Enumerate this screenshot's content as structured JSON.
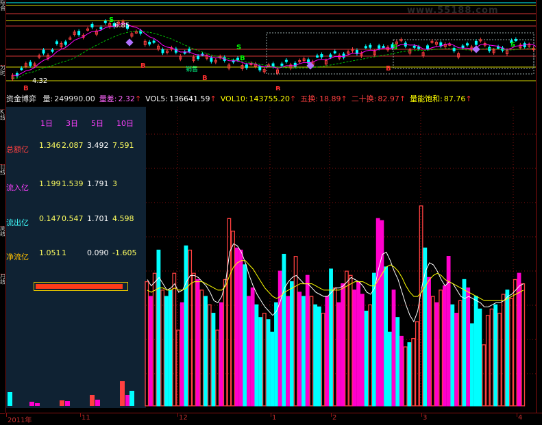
{
  "sidebar": {
    "tabs": [
      "综合",
      "分时",
      "K线",
      "日线",
      "周线",
      "月线"
    ]
  },
  "price_chart": {
    "price_labels": {
      "high": "6.85",
      "low": "4.32"
    },
    "signals": [
      "S",
      "S",
      "S",
      "S",
      "B",
      "B",
      "B",
      "B",
      "B",
      "B"
    ],
    "note_text": "销售"
  },
  "info_bar": {
    "title": "资金博弈",
    "items": [
      {
        "label": "量:",
        "value": "249990.00",
        "color": "#e8e8e8"
      },
      {
        "label": "量差:",
        "value": "2.32",
        "color": "#ff66ff"
      },
      {
        "label": "VOL5:",
        "value": "136641.59",
        "color": "#ffffff"
      },
      {
        "label": "VOL10:",
        "value": "143755.20",
        "color": "#ffff00"
      },
      {
        "label": "五换:",
        "value": "18.89",
        "color": "#ff4040"
      },
      {
        "label": "二十换:",
        "value": "82.97",
        "color": "#ff4040"
      },
      {
        "label": "量能饱和:",
        "value": "87.76",
        "color": "#ffff00"
      }
    ]
  },
  "fund_panel": {
    "headers": [
      "1日",
      "3日",
      "5日",
      "10日"
    ],
    "rows": [
      {
        "label": "总额亿",
        "label_color": "#ff4040",
        "values": [
          "1.346",
          "2.087",
          "3.492",
          "7.591"
        ]
      },
      {
        "label": "流入亿",
        "label_color": "#ff40ff",
        "values": [
          "1.199",
          "1.539",
          "1.791",
          "3"
        ]
      },
      {
        "label": "流出亿",
        "label_color": "#40ffff",
        "values": [
          "0.147",
          "0.547",
          "1.701",
          "4.598"
        ]
      },
      {
        "label": "净流亿",
        "label_color": "#ffc000",
        "values": [
          "1.051",
          "1",
          "0.090",
          "-1.605"
        ]
      }
    ],
    "bar_fill": 0.96
  },
  "x_axis": {
    "labels": [
      "2011年",
      "11",
      "12",
      "1",
      "2",
      "3",
      "4"
    ]
  },
  "watermark": "www.55188.com",
  "colors": {
    "up": "#ff4040",
    "down": "#00ffff",
    "cyan_bar": "#00ffff",
    "magenta_bar": "#ff00cc",
    "ma1": "#ffffff",
    "ma2": "#ffff00",
    "grid": "#8a1010"
  },
  "chart_data": {
    "type": "bar",
    "title": "",
    "categories": [
      "2011年",
      "11",
      "12",
      "1",
      "2",
      "3",
      "4"
    ],
    "series": [
      {
        "name": "量",
        "values": [
          118,
          104,
          126,
          148,
          110,
          104,
          110,
          126,
          72,
          98,
          152,
          148,
          126,
          120,
          110,
          104,
          96,
          88,
          72,
          98,
          120,
          178,
          166,
          150,
          148,
          134,
          104,
          112,
          96,
          84,
          88,
          82,
          70,
          98,
          128,
          144,
          104,
          118,
          142,
          108,
          104,
          124,
          104,
          96,
          94,
          88,
          104,
          130,
          112,
          98,
          116,
          128,
          124,
          110,
          118,
          106,
          90,
          96,
          126,
          178,
          176,
          132,
          70,
          110,
          84,
          66,
          56,
          60,
          64,
          80,
          190,
          150,
          122,
          104,
          98,
          110,
          114,
          142,
          96,
          88,
          100,
          120,
          112,
          78,
          104,
          92,
          58,
          86,
          92,
          96,
          88,
          106,
          110,
          102,
          120,
          126,
          116
        ]
      },
      {
        "name": "VOL5",
        "values": [
          120,
          114,
          118,
          122,
          116,
          110,
          112,
          116,
          108,
          110,
          118,
          124,
          124,
          122,
          118,
          114,
          108,
          100,
          98,
          104,
          118,
          146,
          154,
          152,
          146,
          136,
          124,
          114,
          106,
          100,
          94,
          90,
          86,
          90,
          100,
          112,
          118,
          122,
          124,
          120,
          116,
          116,
          112,
          108,
          106,
          104,
          104,
          108,
          112,
          112,
          114,
          118,
          122,
          120,
          118,
          114,
          108,
          106,
          112,
          130,
          144,
          146,
          138,
          128,
          120,
          108,
          96,
          86,
          80,
          90,
          112,
          128,
          136,
          134,
          128,
          120,
          114,
          118,
          116,
          110,
          104,
          102,
          104,
          102,
          100,
          98,
          94,
          94,
          96,
          98,
          98,
          100,
          104,
          106,
          110,
          114,
          116
        ]
      },
      {
        "name": "VOL10",
        "values": [
          110,
          108,
          110,
          112,
          112,
          110,
          110,
          112,
          110,
          110,
          112,
          116,
          118,
          118,
          118,
          116,
          114,
          112,
          110,
          110,
          114,
          124,
          132,
          136,
          138,
          138,
          134,
          130,
          124,
          118,
          112,
          108,
          104,
          102,
          104,
          108,
          110,
          112,
          114,
          116,
          116,
          116,
          116,
          114,
          112,
          110,
          110,
          110,
          110,
          110,
          112,
          114,
          116,
          118,
          118,
          118,
          116,
          114,
          114,
          120,
          126,
          132,
          134,
          132,
          128,
          122,
          114,
          108,
          104,
          104,
          108,
          114,
          120,
          124,
          126,
          124,
          120,
          118,
          116,
          114,
          112,
          110,
          108,
          106,
          104,
          102,
          100,
          100,
          100,
          100,
          100,
          100,
          102,
          104,
          106,
          108,
          110
        ]
      }
    ],
    "ylabel": "",
    "xlabel": "",
    "grid": true,
    "legend": "top"
  }
}
